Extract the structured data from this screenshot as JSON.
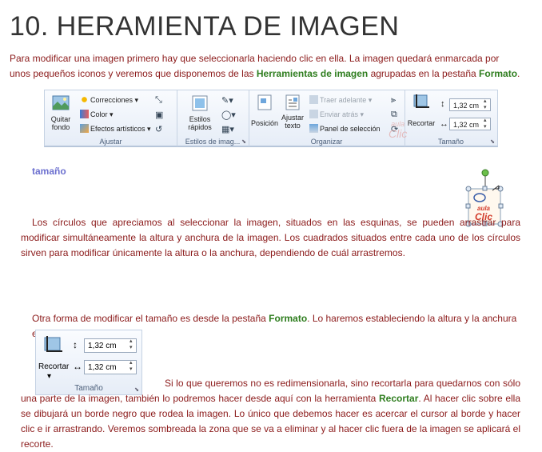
{
  "page": {
    "title": "10. HERAMIENTA DE IMAGEN",
    "intro_part1": "Para modificar una imagen primero hay que seleccionarla haciendo clic en ella. La imagen quedará enmarcada por unos pequeños iconos y veremos que disponemos de las ",
    "intro_bold1": "Herramientas de imagen",
    "intro_part2": " agrupadas en la pestaña ",
    "intro_bold2": "Formato",
    "intro_part3": ".",
    "section_label": "tamaño",
    "para1": "Los círculos que apreciamos al seleccionar la imagen, situados en las esquinas, se pueden arrastrar para modificar simultáneamente la altura y anchura de la imagen. Los cuadrados situados entre cada uno de los círculos sirven para modificar únicamente la altura o la anchura, dependiendo de cuál arrastremos.",
    "para2_part1": "Otra forma de modificar el tamaño es desde la pestaña ",
    "para2_bold": "Formato",
    "para2_part2": ". Lo haremos estableciendo la altura y la anchura en centímetros.",
    "para3_part1": "Si lo que queremos no es redimensionarla, sino recortarla para quedarnos con sólo una parte de la imagen, también lo podremos hacer desde aquí con la herramienta ",
    "para3_bold": "Recortar",
    "para3_part2": ". Al hacer clic sobre ella se dibujará un borde negro que rodea la imagen. Lo único que debemos hacer es acercar el cursor al borde y hacer clic e ir arrastrando. Veremos sombreada la zona que se va a eliminar y al hacer clic fuera de la imagen se aplicará el recorte."
  },
  "ribbon": {
    "quitar_fondo": "Quitar fondo",
    "correcciones": "Correcciones",
    "color": "Color",
    "efectos": "Efectos artísticos",
    "group_ajustar": "Ajustar",
    "estilos_rapidos": "Estilos rápidos",
    "group_estilos": "Estilos de imag...",
    "posicion": "Posición",
    "ajustar_texto": "Ajustar texto",
    "traer_adelante": "Traer adelante",
    "enviar_atras": "Enviar atrás",
    "panel_seleccion": "Panel de selección",
    "group_organizar": "Organizar",
    "recortar": "Recortar",
    "height_value": "1,32 cm",
    "width_value": "1,32 cm",
    "group_tamano": "Tamaño",
    "watermark_top": "aula",
    "watermark_bottom": "Clic"
  },
  "sizebox": {
    "height_value": "1,32 cm",
    "width_value": "1,32 cm",
    "recortar": "Recortar",
    "group_label": "Tamaño"
  },
  "logo": {
    "top": "aula",
    "bottom": "Clic"
  },
  "colors": {
    "text": "#8b1a1a",
    "highlight": "#2e7d1e",
    "label": "#6b6fcf"
  }
}
